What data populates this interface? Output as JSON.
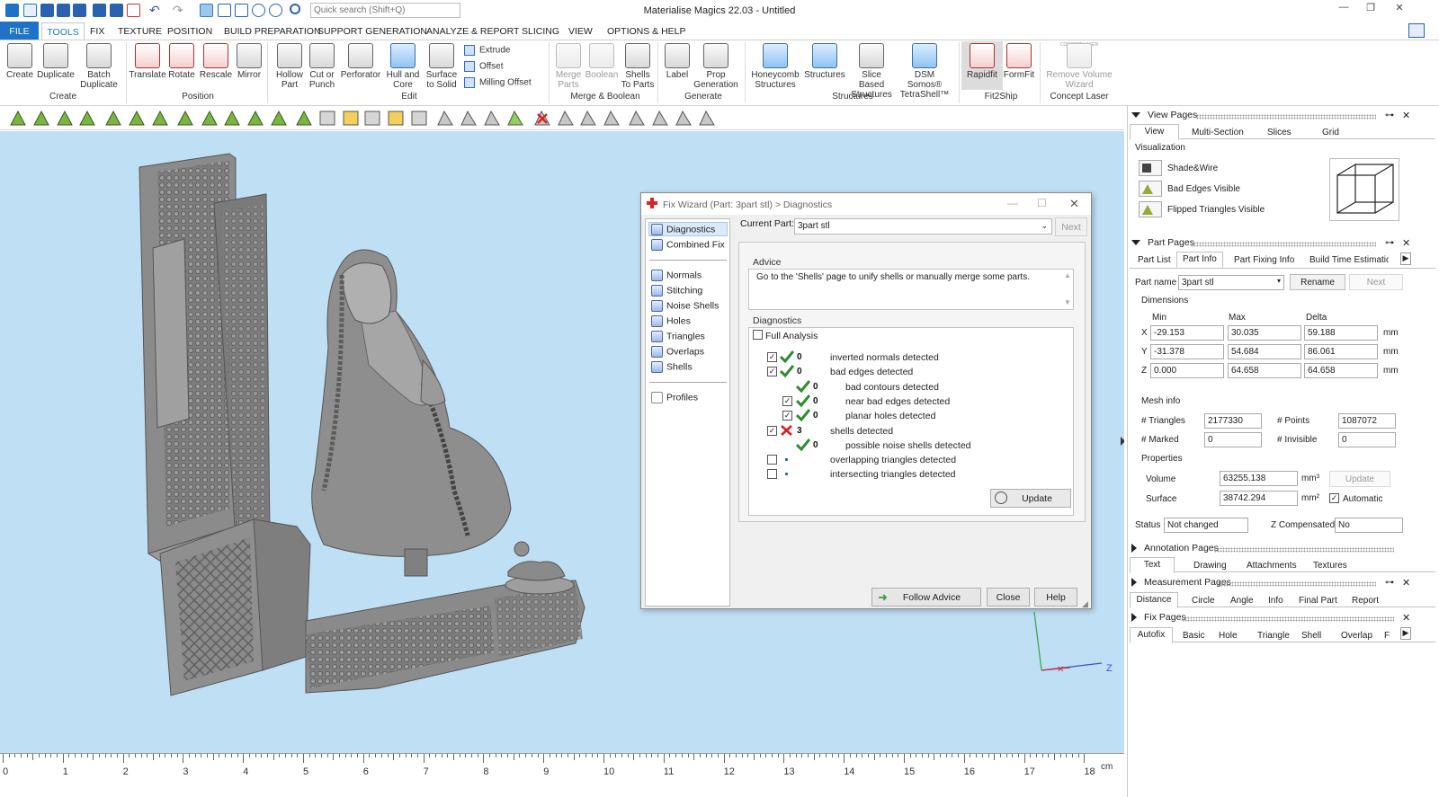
{
  "app": {
    "title": "Materialise Magics 22.03 - Untitled",
    "quick_search_placeholder": "Quick search (Shift+Q)"
  },
  "ribbon_tabs": [
    "FILE",
    "TOOLS",
    "FIX",
    "TEXTURE",
    "POSITION",
    "BUILD PREPARATION",
    "SUPPORT GENERATION",
    "ANALYZE & REPORT",
    "SLICING",
    "VIEW",
    "OPTIONS & HELP"
  ],
  "ribbon": {
    "create": {
      "group": "Create",
      "buttons": [
        "Create",
        "Duplicate",
        "Batch Duplicate"
      ]
    },
    "position": {
      "group": "Position",
      "buttons": [
        "Translate",
        "Rotate",
        "Rescale",
        "Mirror"
      ]
    },
    "edit": {
      "group": "Edit",
      "buttons": [
        "Hollow Part",
        "Cut or Punch",
        "Perforator",
        "Hull and Core",
        "Surface to Solid"
      ],
      "small": [
        "Extrude",
        "Offset",
        "Milling Offset"
      ]
    },
    "merge": {
      "group": "Merge & Boolean",
      "buttons": [
        "Merge Parts",
        "Boolean",
        "Shells To Parts"
      ]
    },
    "generate": {
      "group": "Generate",
      "buttons": [
        "Label",
        "Prop Generation"
      ]
    },
    "structures": {
      "group": "Structures",
      "buttons": [
        "Honeycomb Structures",
        "Structures",
        "Slice Based Structures",
        "DSM Somos® TetraShell™"
      ]
    },
    "fit2ship": {
      "group": "Fit2Ship",
      "buttons": [
        "Rapidfit",
        "FormFit"
      ]
    },
    "concept": {
      "group": "Concept Laser",
      "buttons": [
        "Remove Volume Wizard"
      ],
      "icon_caption": "CONCEPT LASER"
    }
  },
  "ruler": {
    "unit": "cm",
    "ticks": [
      "0",
      "1",
      "2",
      "3",
      "4",
      "5",
      "6",
      "7",
      "8",
      "9",
      "10",
      "11",
      "12",
      "13",
      "14",
      "15",
      "16",
      "17",
      "18"
    ]
  },
  "axis": {
    "z": "Z"
  },
  "dialog": {
    "title": "Fix Wizard (Part: 3part stl) > Diagnostics",
    "nav": [
      "Diagnostics",
      "Combined Fix",
      "Normals",
      "Stitching",
      "Noise Shells",
      "Holes",
      "Triangles",
      "Overlaps",
      "Shells",
      "Profiles"
    ],
    "current_part_label": "Current Part:",
    "current_part_value": "3part stl",
    "next": "Next",
    "advice_label": "Advice",
    "advice_text": "Go to the 'Shells' page to unify shells or manually merge some parts.",
    "diagnostics_label": "Diagnostics",
    "full_analysis": "Full Analysis",
    "rows": [
      {
        "count": "0",
        "text": "inverted normals detected",
        "checked": true,
        "status": "ok"
      },
      {
        "count": "0",
        "text": "bad edges detected",
        "checked": true,
        "status": "ok"
      },
      {
        "count": "0",
        "text": "bad contours detected",
        "checked": null,
        "status": "ok"
      },
      {
        "count": "0",
        "text": "near bad edges detected",
        "checked": true,
        "status": "ok"
      },
      {
        "count": "0",
        "text": "planar holes detected",
        "checked": true,
        "status": "ok"
      },
      {
        "count": "3",
        "text": "shells detected",
        "checked": true,
        "status": "error"
      },
      {
        "count": "0",
        "text": "possible noise shells detected",
        "checked": null,
        "status": "ok"
      },
      {
        "count": "",
        "text": "overlapping triangles detected",
        "checked": false,
        "status": "none"
      },
      {
        "count": "",
        "text": "intersecting triangles detected",
        "checked": false,
        "status": "none"
      }
    ],
    "update": "Update",
    "follow_advice": "Follow Advice",
    "close": "Close",
    "help": "Help"
  },
  "view_pages": {
    "title": "View Pages",
    "tabs": [
      "View",
      "Multi-Section",
      "Slices",
      "Grid"
    ],
    "visualization_label": "Visualization",
    "items": [
      "Shade&Wire",
      "Bad Edges Visible",
      "Flipped Triangles Visible"
    ]
  },
  "part_pages": {
    "title": "Part Pages",
    "tabs": [
      "Part List",
      "Part Info",
      "Part Fixing Info",
      "Build Time Estimation"
    ],
    "part_name_label": "Part name",
    "part_name": "3part stl",
    "rename": "Rename",
    "next": "Next",
    "dimensions_label": "Dimensions",
    "col_headers": [
      "Min",
      "Max",
      "Delta"
    ],
    "unit": "mm",
    "dims": [
      {
        "axis": "X",
        "min": "-29.153",
        "max": "30.035",
        "delta": "59.188"
      },
      {
        "axis": "Y",
        "min": "-31.378",
        "max": "54.684",
        "delta": "86.061"
      },
      {
        "axis": "Z",
        "min": "0.000",
        "max": "64.658",
        "delta": "64.658"
      }
    ],
    "mesh_info_label": "Mesh info",
    "triangles_label": "# Triangles",
    "triangles": "2177330",
    "points_label": "# Points",
    "points": "1087072",
    "marked_label": "# Marked",
    "marked": "0",
    "invisible_label": "# Invisible",
    "invisible": "0",
    "properties_label": "Properties",
    "volume_label": "Volume",
    "volume": "63255.138",
    "volume_unit": "mm³",
    "update": "Update",
    "surface_label": "Surface",
    "surface": "38742.294",
    "surface_unit": "mm²",
    "automatic": "Automatic",
    "status_label": "Status",
    "status": "Not changed",
    "zcomp_label": "Z Compensated",
    "zcomp": "No"
  },
  "annotation_pages": {
    "title": "Annotation Pages",
    "tabs": [
      "Text",
      "Drawing",
      "Attachments",
      "Textures"
    ]
  },
  "measurement_pages": {
    "title": "Measurement Pages",
    "tabs": [
      "Distance",
      "Circle",
      "Angle",
      "Info",
      "Final Part",
      "Report"
    ]
  },
  "fix_pages": {
    "title": "Fix Pages",
    "tabs": [
      "Autofix",
      "Basic",
      "Hole",
      "Triangle",
      "Shell",
      "Overlap",
      "F"
    ]
  },
  "colors": {
    "accent": "#1e73c8",
    "viewport": "#bfdff5",
    "ok_green": "#2e8b2e",
    "error_red": "#d42020",
    "model_gray": "#8c8c8c"
  }
}
